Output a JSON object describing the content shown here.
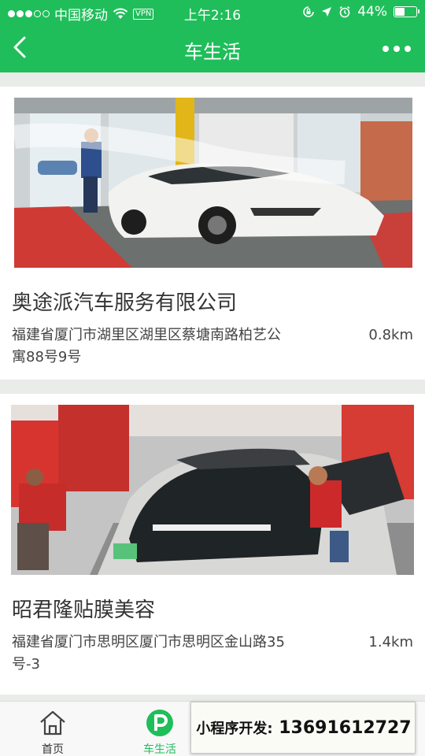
{
  "status_bar": {
    "carrier": "中国移动",
    "vpn": "VPN",
    "time": "上午2:16",
    "battery": "44%",
    "battery_level": 0.44
  },
  "navbar": {
    "title": "车生活"
  },
  "shops": [
    {
      "name": "奥途派汽车服务有限公司",
      "address": "福建省厦门市湖里区湖里区蔡塘南路柏艺公寓88号9号",
      "distance": "0.8km"
    },
    {
      "name": "昭君隆贴膜美容",
      "address": "福建省厦门市思明区厦门市思明区金山路35号-3",
      "distance": "1.4km"
    }
  ],
  "tabbar": {
    "home_label": "首页",
    "life_label": "车生活",
    "accent": "#1fbe5a"
  },
  "promo": {
    "label": "小程序开发:",
    "phone": "13691612727"
  }
}
